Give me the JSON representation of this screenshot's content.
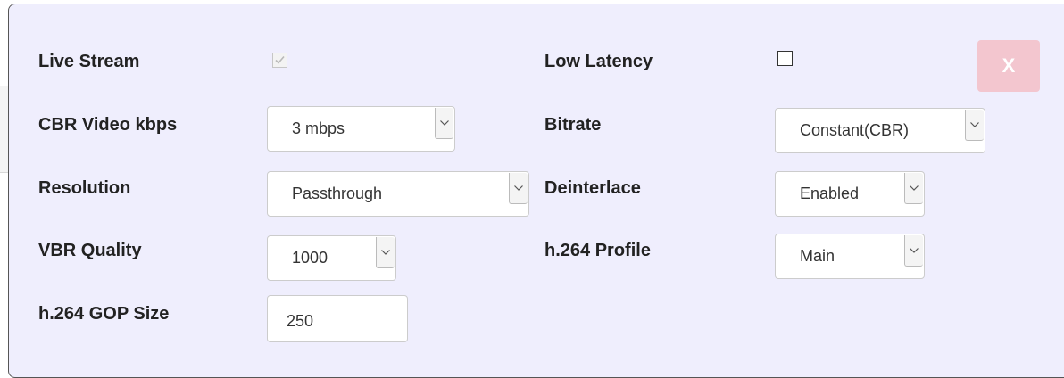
{
  "form": {
    "live_stream": {
      "label": "Live Stream",
      "checked": true,
      "disabled": true
    },
    "low_latency": {
      "label": "Low Latency",
      "checked": false
    },
    "close_button": {
      "label": "X"
    },
    "cbr_video_kbps": {
      "label": "CBR Video kbps",
      "value": "3 mbps"
    },
    "bitrate": {
      "label": "Bitrate",
      "value": "Constant(CBR)"
    },
    "resolution": {
      "label": "Resolution",
      "value": "Passthrough"
    },
    "deinterlace": {
      "label": "Deinterlace",
      "value": "Enabled"
    },
    "vbr_quality": {
      "label": "VBR Quality",
      "value": "1000"
    },
    "h264_profile": {
      "label": "h.264 Profile",
      "value": "Main"
    },
    "h264_gop_size": {
      "label": "h.264 GOP Size",
      "value": "250"
    }
  },
  "colors": {
    "panel_background": "#efeefd",
    "close_button_background": "#f3c6cf"
  },
  "icons": {
    "checkmark": "check-icon",
    "dropdown": "chevron-down-icon"
  }
}
